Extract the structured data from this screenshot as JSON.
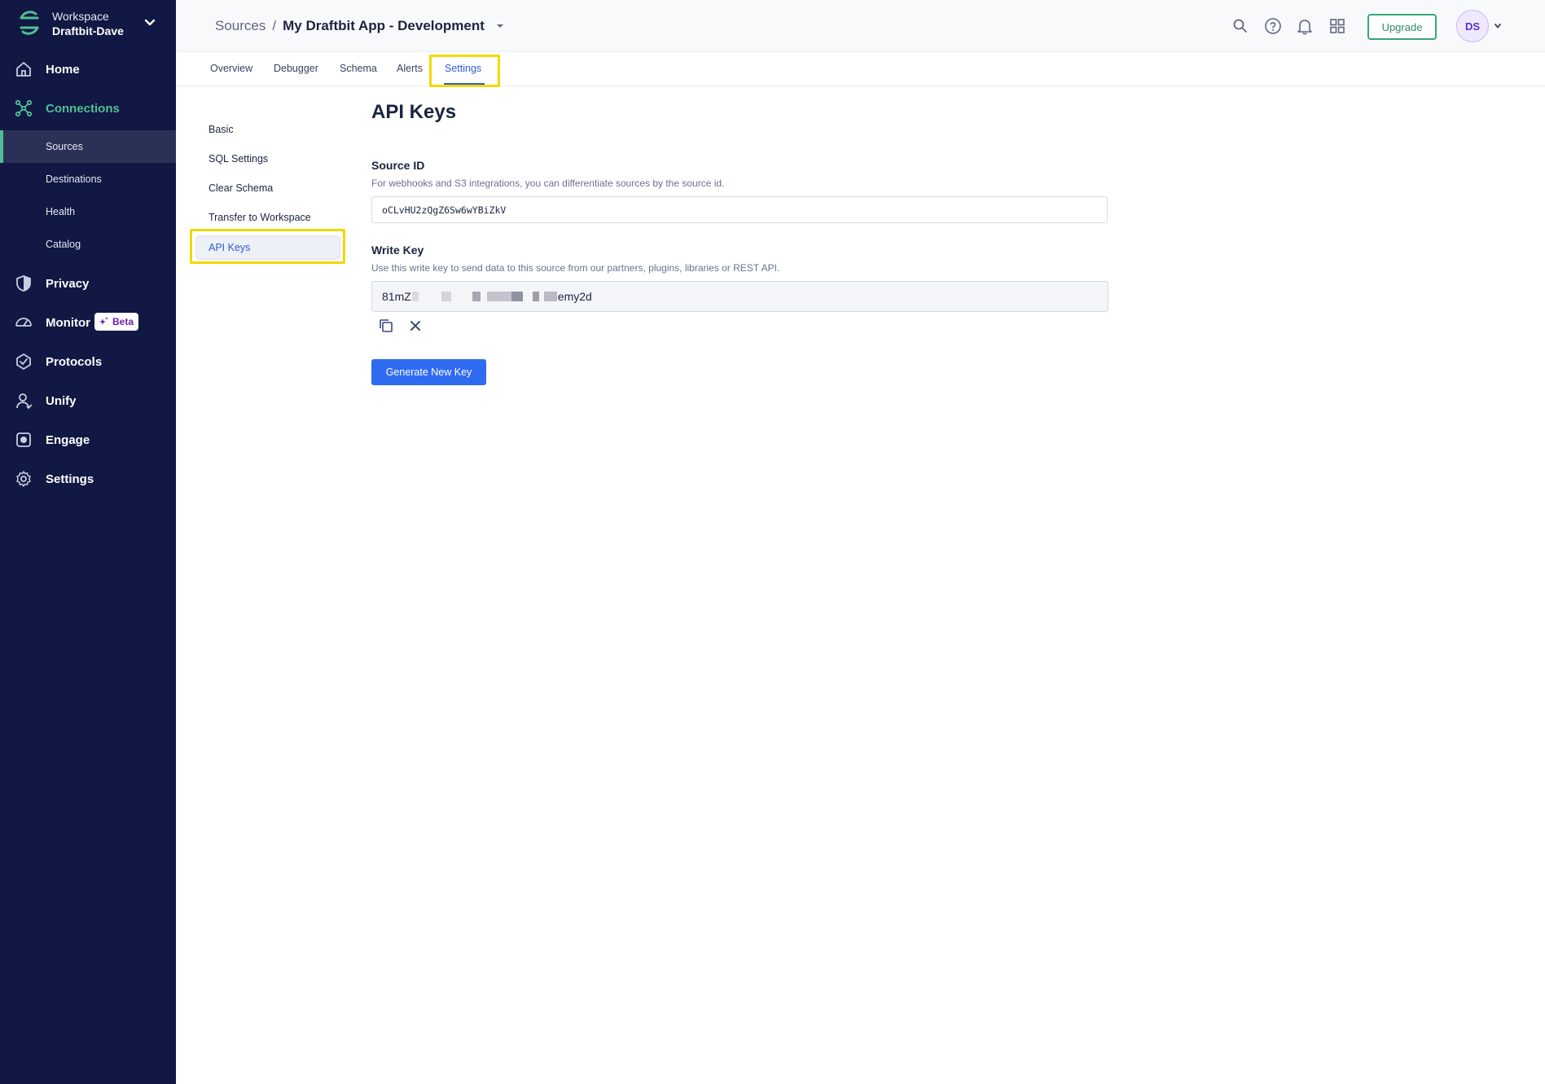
{
  "workspace": {
    "label": "Workspace",
    "name": "Draftbit-Dave"
  },
  "sidebar": {
    "items": [
      {
        "label": "Home",
        "icon": "home-icon"
      },
      {
        "label": "Connections",
        "icon": "connections-icon"
      },
      {
        "label": "Privacy",
        "icon": "shield-icon"
      },
      {
        "label": "Monitor",
        "icon": "gauge-icon"
      },
      {
        "label": "Protocols",
        "icon": "protocols-icon"
      },
      {
        "label": "Unify",
        "icon": "user-icon"
      },
      {
        "label": "Engage",
        "icon": "engage-icon"
      },
      {
        "label": "Settings",
        "icon": "gear-icon"
      }
    ],
    "connections_sub": [
      {
        "label": "Sources"
      },
      {
        "label": "Destinations"
      },
      {
        "label": "Health"
      },
      {
        "label": "Catalog"
      }
    ],
    "monitor_badge": "Beta",
    "active_color": "#52bd94",
    "background": "#101843"
  },
  "header": {
    "breadcrumb_root": "Sources",
    "separator": "/",
    "breadcrumb_current": "My Draftbit App - Development",
    "upgrade_label": "Upgrade",
    "avatar_initials": "DS",
    "icons": [
      "search-icon",
      "help-icon",
      "bell-icon",
      "apps-grid-icon"
    ]
  },
  "tabs": [
    {
      "label": "Overview"
    },
    {
      "label": "Debugger"
    },
    {
      "label": "Schema"
    },
    {
      "label": "Alerts"
    },
    {
      "label": "Settings"
    }
  ],
  "settings_menu": [
    {
      "label": "Basic"
    },
    {
      "label": "SQL Settings"
    },
    {
      "label": "Clear Schema"
    },
    {
      "label": "Transfer to Workspace"
    },
    {
      "label": "API Keys"
    }
  ],
  "main": {
    "title": "API Keys",
    "source_id": {
      "label": "Source ID",
      "help": "For webhooks and S3 integrations, you can differentiate sources by the source id.",
      "value": "oCLvHU2zQgZ6Sw6wYBiZkV"
    },
    "write_key": {
      "label": "Write Key",
      "help": "Use this write key to send data to this source from our partners, plugins, libraries or REST API.",
      "value_prefix": "81mZ",
      "value_suffix": "emy2d"
    },
    "generate_label": "Generate New Key"
  },
  "colors": {
    "accent": "#2f6bf0",
    "highlight": "#f4d800",
    "upgrade": "#3aa579"
  }
}
